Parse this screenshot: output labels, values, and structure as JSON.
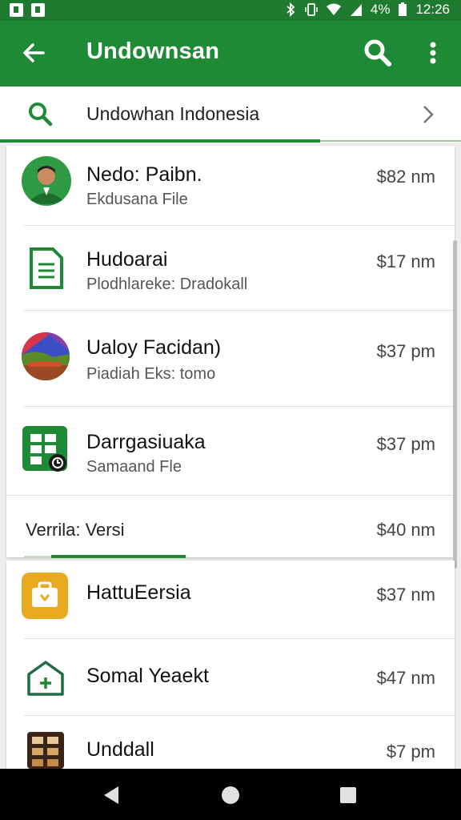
{
  "status_bar": {
    "battery": "4%",
    "time": "12:26"
  },
  "app_bar": {
    "title": "Undownsan"
  },
  "search": {
    "text": "Undowhan Indonesia"
  },
  "items": [
    {
      "name": "Nedo: Paibn.",
      "subtitle": "Ekdusana File",
      "amount": "$82 nm",
      "icon": "person-avatar-icon"
    },
    {
      "name": "Hudoarai",
      "subtitle": "Plodhlareke: Dradokall",
      "amount": "$17 nm",
      "icon": "document-icon"
    },
    {
      "name": "Ualoy Facidan)",
      "subtitle": "Piadiah Eks: tomo",
      "amount": "$37 pm",
      "icon": "photo-thumbnail-icon"
    },
    {
      "name": "Darrgasiuaka",
      "subtitle": "Samaand Fle",
      "amount": "$37 pm",
      "icon": "spreadsheet-icon"
    }
  ],
  "version_row": {
    "label": "Verrila: Versi",
    "amount": "$40 nm"
  },
  "items2": [
    {
      "name": "HattuEersia",
      "amount": "$37 nm",
      "icon": "briefcase-icon"
    },
    {
      "name": "Somal Yeaekt",
      "amount": "$47 nm",
      "icon": "home-plus-icon"
    },
    {
      "name": "Unddall",
      "amount": "$7 pm",
      "icon": "calculator-icon"
    }
  ],
  "colors": {
    "primary": "#1f8a35",
    "primary_dark": "#1e7a2e",
    "accent_yellow": "#e8a820"
  }
}
